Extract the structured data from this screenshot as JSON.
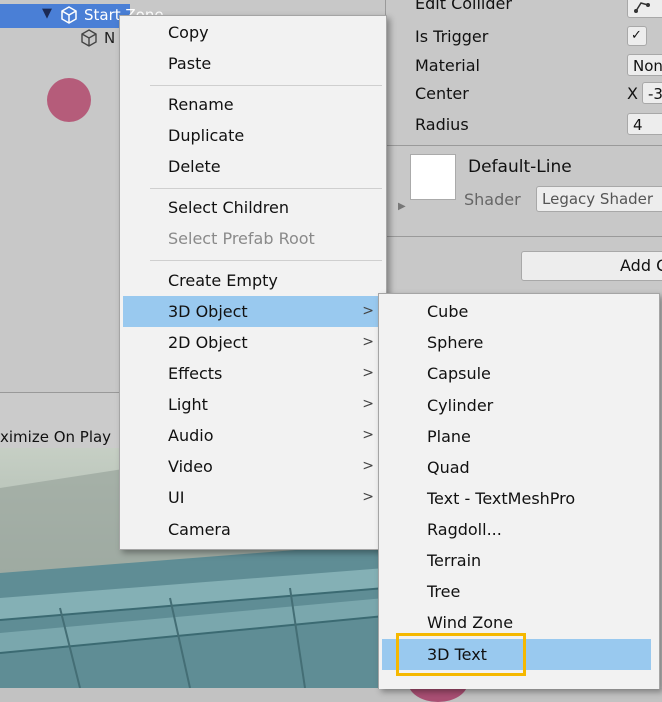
{
  "hierarchy": {
    "selected_item": "Start Zone",
    "child_item": "N"
  },
  "game_toolbar": {
    "maximize_label": "ximize On Play"
  },
  "inspector": {
    "edit_collider_label": "Edit Collider",
    "is_trigger_label": "Is Trigger",
    "is_trigger_value": "✓",
    "material_label": "Material",
    "material_value": "Non",
    "center_label": "Center",
    "center_x_label": "X",
    "center_x_value": "-3",
    "radius_label": "Radius",
    "radius_value": "4",
    "material_name": "Default-Line",
    "shader_label": "Shader",
    "shader_value": "Legacy Shader",
    "add_component_label": "Add C"
  },
  "context_menu": {
    "items": [
      {
        "label": "Copy"
      },
      {
        "label": "Paste"
      },
      {
        "label": "Rename"
      },
      {
        "label": "Duplicate"
      },
      {
        "label": "Delete"
      },
      {
        "label": "Select Children"
      },
      {
        "label": "Select Prefab Root"
      },
      {
        "label": "Create Empty"
      },
      {
        "label": "3D Object"
      },
      {
        "label": "2D Object"
      },
      {
        "label": "Effects"
      },
      {
        "label": "Light"
      },
      {
        "label": "Audio"
      },
      {
        "label": "Video"
      },
      {
        "label": "UI"
      },
      {
        "label": "Camera"
      }
    ],
    "submenu_arrow": ">"
  },
  "submenu_3d": {
    "items": [
      {
        "label": "Cube"
      },
      {
        "label": "Sphere"
      },
      {
        "label": "Capsule"
      },
      {
        "label": "Cylinder"
      },
      {
        "label": "Plane"
      },
      {
        "label": "Quad"
      },
      {
        "label": "Text - TextMeshPro"
      },
      {
        "label": "Ragdoll..."
      },
      {
        "label": "Terrain"
      },
      {
        "label": "Tree"
      },
      {
        "label": "Wind Zone"
      },
      {
        "label": "3D Text"
      }
    ]
  },
  "colors": {
    "highlight": "#99c9ef",
    "annotation_box": "#f5b800",
    "hierarchy_selection": "#4a7fd6"
  }
}
